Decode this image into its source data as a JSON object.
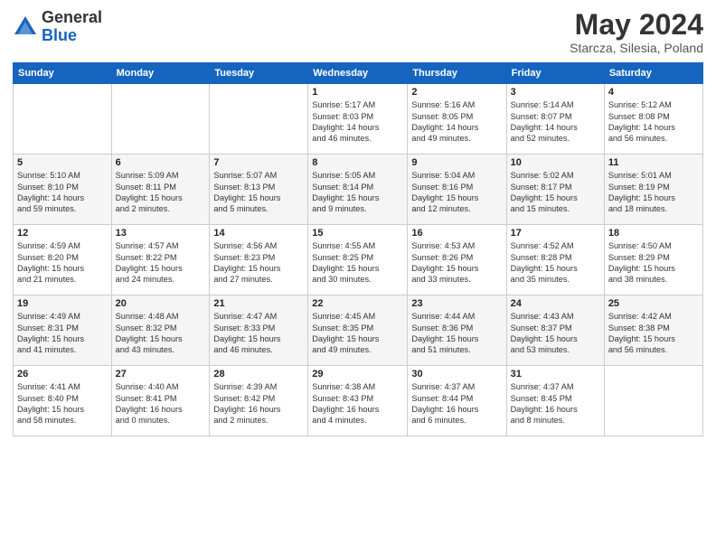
{
  "header": {
    "logo_general": "General",
    "logo_blue": "Blue",
    "month_title": "May 2024",
    "location": "Starcza, Silesia, Poland"
  },
  "weekdays": [
    "Sunday",
    "Monday",
    "Tuesday",
    "Wednesday",
    "Thursday",
    "Friday",
    "Saturday"
  ],
  "weeks": [
    [
      {
        "day": "",
        "info": ""
      },
      {
        "day": "",
        "info": ""
      },
      {
        "day": "",
        "info": ""
      },
      {
        "day": "1",
        "info": "Sunrise: 5:17 AM\nSunset: 8:03 PM\nDaylight: 14 hours\nand 46 minutes."
      },
      {
        "day": "2",
        "info": "Sunrise: 5:16 AM\nSunset: 8:05 PM\nDaylight: 14 hours\nand 49 minutes."
      },
      {
        "day": "3",
        "info": "Sunrise: 5:14 AM\nSunset: 8:07 PM\nDaylight: 14 hours\nand 52 minutes."
      },
      {
        "day": "4",
        "info": "Sunrise: 5:12 AM\nSunset: 8:08 PM\nDaylight: 14 hours\nand 56 minutes."
      }
    ],
    [
      {
        "day": "5",
        "info": "Sunrise: 5:10 AM\nSunset: 8:10 PM\nDaylight: 14 hours\nand 59 minutes."
      },
      {
        "day": "6",
        "info": "Sunrise: 5:09 AM\nSunset: 8:11 PM\nDaylight: 15 hours\nand 2 minutes."
      },
      {
        "day": "7",
        "info": "Sunrise: 5:07 AM\nSunset: 8:13 PM\nDaylight: 15 hours\nand 5 minutes."
      },
      {
        "day": "8",
        "info": "Sunrise: 5:05 AM\nSunset: 8:14 PM\nDaylight: 15 hours\nand 9 minutes."
      },
      {
        "day": "9",
        "info": "Sunrise: 5:04 AM\nSunset: 8:16 PM\nDaylight: 15 hours\nand 12 minutes."
      },
      {
        "day": "10",
        "info": "Sunrise: 5:02 AM\nSunset: 8:17 PM\nDaylight: 15 hours\nand 15 minutes."
      },
      {
        "day": "11",
        "info": "Sunrise: 5:01 AM\nSunset: 8:19 PM\nDaylight: 15 hours\nand 18 minutes."
      }
    ],
    [
      {
        "day": "12",
        "info": "Sunrise: 4:59 AM\nSunset: 8:20 PM\nDaylight: 15 hours\nand 21 minutes."
      },
      {
        "day": "13",
        "info": "Sunrise: 4:57 AM\nSunset: 8:22 PM\nDaylight: 15 hours\nand 24 minutes."
      },
      {
        "day": "14",
        "info": "Sunrise: 4:56 AM\nSunset: 8:23 PM\nDaylight: 15 hours\nand 27 minutes."
      },
      {
        "day": "15",
        "info": "Sunrise: 4:55 AM\nSunset: 8:25 PM\nDaylight: 15 hours\nand 30 minutes."
      },
      {
        "day": "16",
        "info": "Sunrise: 4:53 AM\nSunset: 8:26 PM\nDaylight: 15 hours\nand 33 minutes."
      },
      {
        "day": "17",
        "info": "Sunrise: 4:52 AM\nSunset: 8:28 PM\nDaylight: 15 hours\nand 35 minutes."
      },
      {
        "day": "18",
        "info": "Sunrise: 4:50 AM\nSunset: 8:29 PM\nDaylight: 15 hours\nand 38 minutes."
      }
    ],
    [
      {
        "day": "19",
        "info": "Sunrise: 4:49 AM\nSunset: 8:31 PM\nDaylight: 15 hours\nand 41 minutes."
      },
      {
        "day": "20",
        "info": "Sunrise: 4:48 AM\nSunset: 8:32 PM\nDaylight: 15 hours\nand 43 minutes."
      },
      {
        "day": "21",
        "info": "Sunrise: 4:47 AM\nSunset: 8:33 PM\nDaylight: 15 hours\nand 46 minutes."
      },
      {
        "day": "22",
        "info": "Sunrise: 4:45 AM\nSunset: 8:35 PM\nDaylight: 15 hours\nand 49 minutes."
      },
      {
        "day": "23",
        "info": "Sunrise: 4:44 AM\nSunset: 8:36 PM\nDaylight: 15 hours\nand 51 minutes."
      },
      {
        "day": "24",
        "info": "Sunrise: 4:43 AM\nSunset: 8:37 PM\nDaylight: 15 hours\nand 53 minutes."
      },
      {
        "day": "25",
        "info": "Sunrise: 4:42 AM\nSunset: 8:38 PM\nDaylight: 15 hours\nand 56 minutes."
      }
    ],
    [
      {
        "day": "26",
        "info": "Sunrise: 4:41 AM\nSunset: 8:40 PM\nDaylight: 15 hours\nand 58 minutes."
      },
      {
        "day": "27",
        "info": "Sunrise: 4:40 AM\nSunset: 8:41 PM\nDaylight: 16 hours\nand 0 minutes."
      },
      {
        "day": "28",
        "info": "Sunrise: 4:39 AM\nSunset: 8:42 PM\nDaylight: 16 hours\nand 2 minutes."
      },
      {
        "day": "29",
        "info": "Sunrise: 4:38 AM\nSunset: 8:43 PM\nDaylight: 16 hours\nand 4 minutes."
      },
      {
        "day": "30",
        "info": "Sunrise: 4:37 AM\nSunset: 8:44 PM\nDaylight: 16 hours\nand 6 minutes."
      },
      {
        "day": "31",
        "info": "Sunrise: 4:37 AM\nSunset: 8:45 PM\nDaylight: 16 hours\nand 8 minutes."
      },
      {
        "day": "",
        "info": ""
      }
    ]
  ]
}
